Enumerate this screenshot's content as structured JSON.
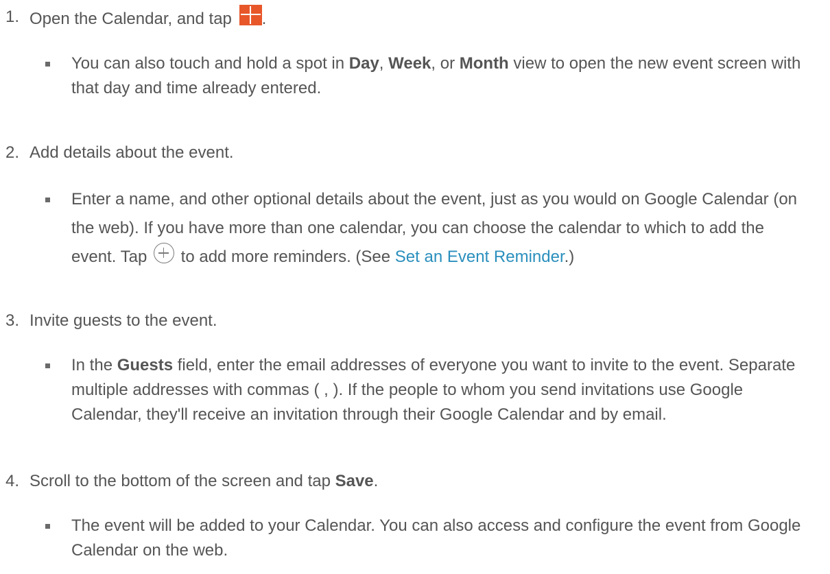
{
  "steps": [
    {
      "number": "1.",
      "text_before_icon": "Open the Calendar, and tap",
      "text_after_icon": ".",
      "icon": "orange-plus-icon",
      "bullet": {
        "text1": "You can also touch and hold a spot in ",
        "bold1": "Day",
        "text2": ", ",
        "bold2": "Week",
        "text3": ", or ",
        "bold3": "Month",
        "text4": " view to open the new event screen with that day and time already entered."
      }
    },
    {
      "number": "2.",
      "text": "Add details about the event.",
      "bullet": {
        "text1": "Enter a name, and other optional details about the event, just as you would on Google Calendar (on the web). If you have more than one calendar, you can choose the calendar to which to add the event. Tap",
        "icon": "circle-plus-icon",
        "text2": "to add more reminders. (See ",
        "link": "Set an Event Reminder",
        "text3": ".)"
      }
    },
    {
      "number": "3.",
      "text": "Invite guests to the event.",
      "bullet": {
        "text1": "In the ",
        "bold1": "Guests",
        "text2": " field, enter the email addresses of everyone you want to invite to the event. Separate multiple addresses with commas ( , ). If the people to whom you send invitations use Google Calendar, they'll receive an invitation through their Google Calendar and by email."
      }
    },
    {
      "number": "4.",
      "text": "Scroll to the bottom of the screen and tap ",
      "bold": "Save",
      "text_end": ".",
      "bullet": {
        "text1": "The event will be added to your Calendar. You can also access and configure the event from Google Calendar on the web."
      }
    }
  ],
  "colors": {
    "text": "#555555",
    "link": "#2a8fbd",
    "accent": "#e8572a"
  }
}
